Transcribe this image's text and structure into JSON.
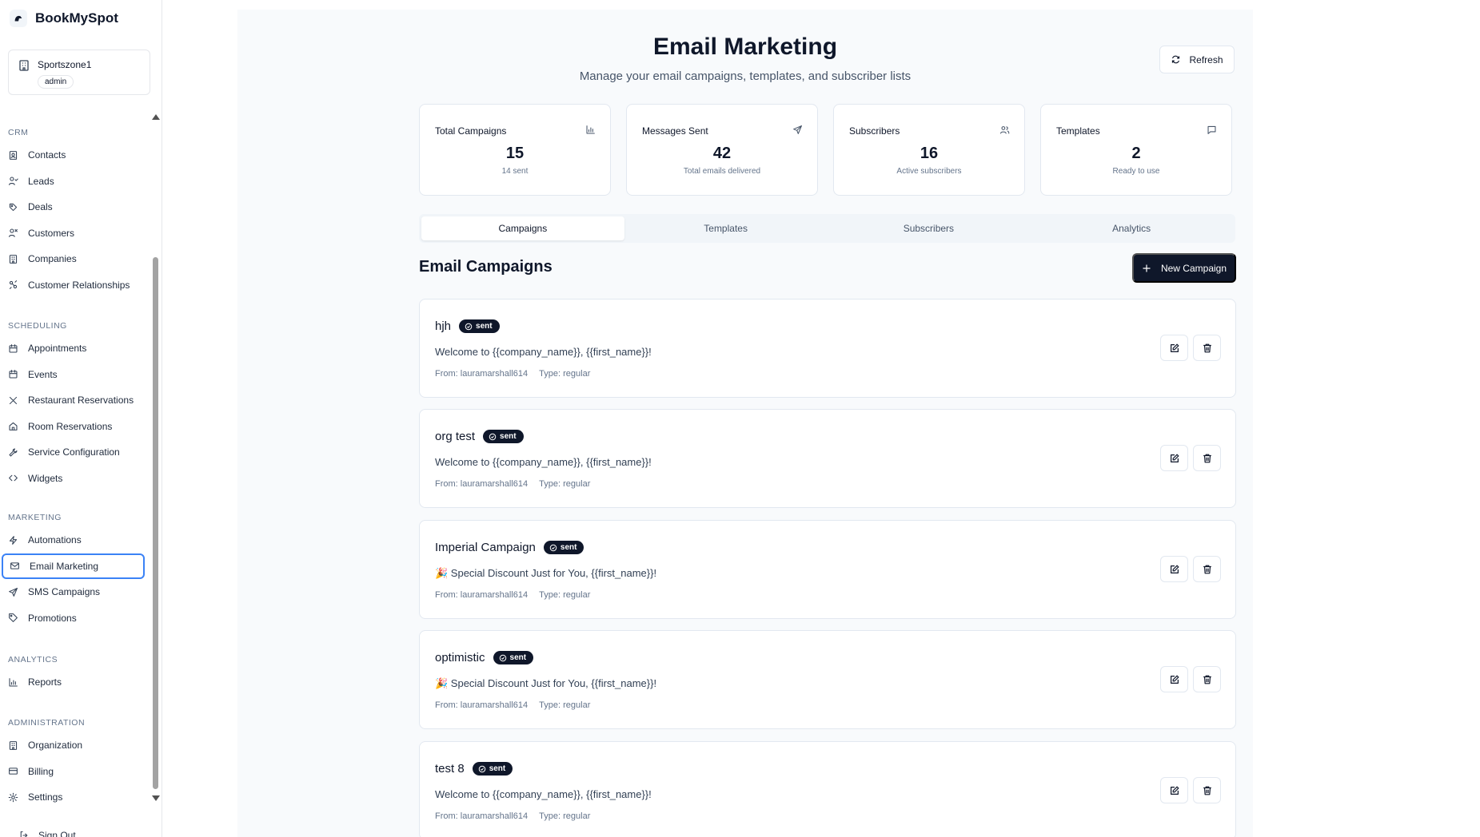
{
  "app": {
    "name": "BookMySpot"
  },
  "org": {
    "name": "Sportszone1",
    "role": "admin"
  },
  "sidebar": {
    "sections": [
      {
        "heading": "CRM",
        "items": [
          {
            "label": "Contacts",
            "icon": "contacts-icon"
          },
          {
            "label": "Leads",
            "icon": "leads-icon"
          },
          {
            "label": "Deals",
            "icon": "deals-icon"
          },
          {
            "label": "Customers",
            "icon": "customers-icon"
          },
          {
            "label": "Companies",
            "icon": "companies-icon"
          },
          {
            "label": "Customer Relationships",
            "icon": "relationships-icon"
          }
        ]
      },
      {
        "heading": "SCHEDULING",
        "items": [
          {
            "label": "Appointments",
            "icon": "calendar-icon"
          },
          {
            "label": "Events",
            "icon": "calendar-icon"
          },
          {
            "label": "Restaurant Reservations",
            "icon": "utensils-icon"
          },
          {
            "label": "Room Reservations",
            "icon": "home-icon"
          },
          {
            "label": "Service Configuration",
            "icon": "wrench-icon"
          },
          {
            "label": "Widgets",
            "icon": "code-icon"
          }
        ]
      },
      {
        "heading": "MARKETING",
        "items": [
          {
            "label": "Automations",
            "icon": "zap-icon"
          },
          {
            "label": "Email Marketing",
            "icon": "mail-icon",
            "active": true
          },
          {
            "label": "SMS Campaigns",
            "icon": "send-icon"
          },
          {
            "label": "Promotions",
            "icon": "tag-icon"
          }
        ]
      },
      {
        "heading": "ANALYTICS",
        "items": [
          {
            "label": "Reports",
            "icon": "bar-chart-icon"
          }
        ]
      },
      {
        "heading": "ADMINISTRATION",
        "items": [
          {
            "label": "Organization",
            "icon": "building-icon"
          },
          {
            "label": "Billing",
            "icon": "credit-card-icon"
          },
          {
            "label": "Settings",
            "icon": "gear-icon"
          }
        ]
      }
    ],
    "signout": "Sign Out"
  },
  "header": {
    "title": "Email Marketing",
    "subtitle": "Manage your email campaigns, templates, and subscriber lists",
    "refresh_label": "Refresh"
  },
  "stats": [
    {
      "label": "Total Campaigns",
      "value": "15",
      "sub": "14 sent",
      "icon": "bar-chart-icon"
    },
    {
      "label": "Messages Sent",
      "value": "42",
      "sub": "Total emails delivered",
      "icon": "send-icon"
    },
    {
      "label": "Subscribers",
      "value": "16",
      "sub": "Active subscribers",
      "icon": "users-icon"
    },
    {
      "label": "Templates",
      "value": "2",
      "sub": "Ready to use",
      "icon": "message-square-icon"
    }
  ],
  "tabs": [
    {
      "label": "Campaigns",
      "active": true
    },
    {
      "label": "Templates"
    },
    {
      "label": "Subscribers"
    },
    {
      "label": "Analytics"
    }
  ],
  "campaigns_section": {
    "title": "Email Campaigns",
    "new_label": "New Campaign"
  },
  "campaigns": [
    {
      "name": "hjh",
      "status": "sent",
      "subject": "Welcome to {{company_name}}, {{first_name}}!",
      "from": "From: lauramarshall614",
      "type": "Type: regular"
    },
    {
      "name": "org test",
      "status": "sent",
      "subject": "Welcome to {{company_name}}, {{first_name}}!",
      "from": "From: lauramarshall614",
      "type": "Type: regular"
    },
    {
      "name": "Imperial Campaign",
      "status": "sent",
      "subject": "🎉 Special Discount Just for You, {{first_name}}!",
      "from": "From: lauramarshall614",
      "type": "Type: regular"
    },
    {
      "name": "optimistic",
      "status": "sent",
      "subject": "🎉 Special Discount Just for You, {{first_name}}!",
      "from": "From: lauramarshall614",
      "type": "Type: regular"
    },
    {
      "name": "test 8",
      "status": "sent",
      "subject": "Welcome to {{company_name}}, {{first_name}}!",
      "from": "From: lauramarshall614",
      "type": "Type: regular"
    }
  ]
}
